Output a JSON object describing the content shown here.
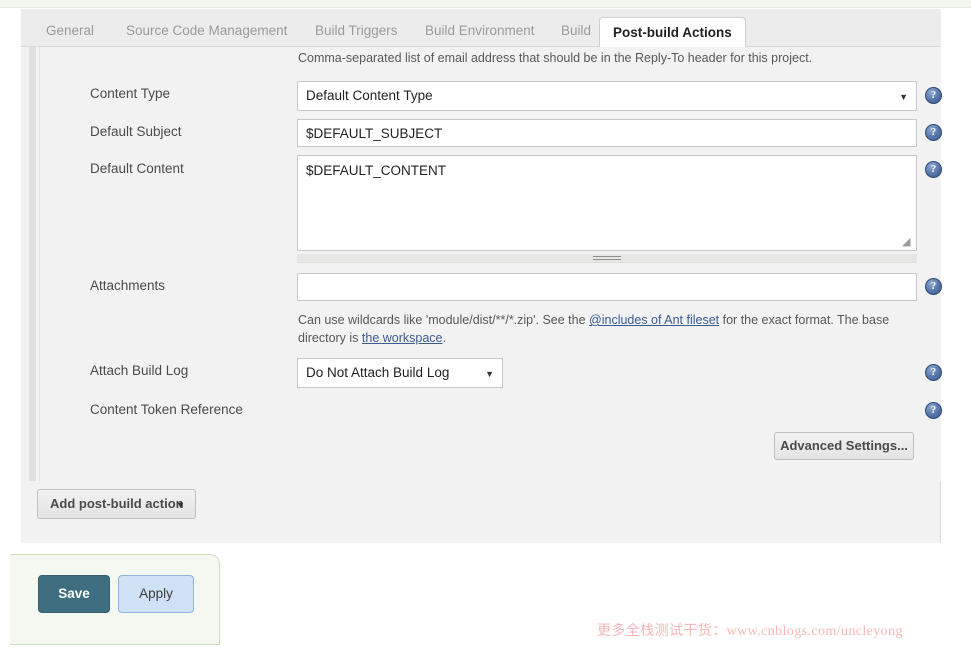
{
  "tabs": [
    {
      "label": "General",
      "active": false
    },
    {
      "label": "Source Code Management",
      "active": false
    },
    {
      "label": "Build Triggers",
      "active": false
    },
    {
      "label": "Build Environment",
      "active": false
    },
    {
      "label": "Build",
      "active": false
    },
    {
      "label": "Post-build Actions",
      "active": true
    }
  ],
  "form": {
    "top_hint": "Comma-separated list of email address that should be in the Reply-To header for this project.",
    "content_type": {
      "label": "Content Type",
      "value": "Default Content Type",
      "caret": "▼"
    },
    "default_subject": {
      "label": "Default Subject",
      "value": "$DEFAULT_SUBJECT",
      "placeholder": ""
    },
    "default_content": {
      "label": "Default Content",
      "value": "$DEFAULT_CONTENT",
      "placeholder": ""
    },
    "attachments": {
      "label": "Attachments",
      "value": "",
      "placeholder": "",
      "hint_part1": "Can use wildcards like 'module/dist/**/*.zip'. See the ",
      "hint_link1": "@includes of Ant fileset",
      "hint_part2": " for the exact format. The base directory is ",
      "hint_link2": "the workspace",
      "hint_part3": "."
    },
    "attach_build_log": {
      "label": "Attach Build Log",
      "value": "Do Not Attach Build Log",
      "caret": "▼"
    },
    "content_token_reference": {
      "label": "Content Token Reference"
    },
    "advanced_settings_label": "Advanced Settings...",
    "add_post_build_action_label": "Add post-build action",
    "add_post_build_action_caret": "▼",
    "help_icon_glyph": "?"
  },
  "footer": {
    "save_label": "Save",
    "apply_label": "Apply"
  },
  "watermark": {
    "text": "更多全栈测试干货：www.cnblogs.com/uncleyong",
    "color": "#f6b6b6"
  },
  "colors": {
    "save_button": "#3e6e80",
    "apply_button": "#cfe2f5",
    "panel_bg": "#f2f2f2",
    "tab_bar_bg": "#ececec",
    "help_icon": "#3d5b8d",
    "link": "#3b5a8f"
  }
}
